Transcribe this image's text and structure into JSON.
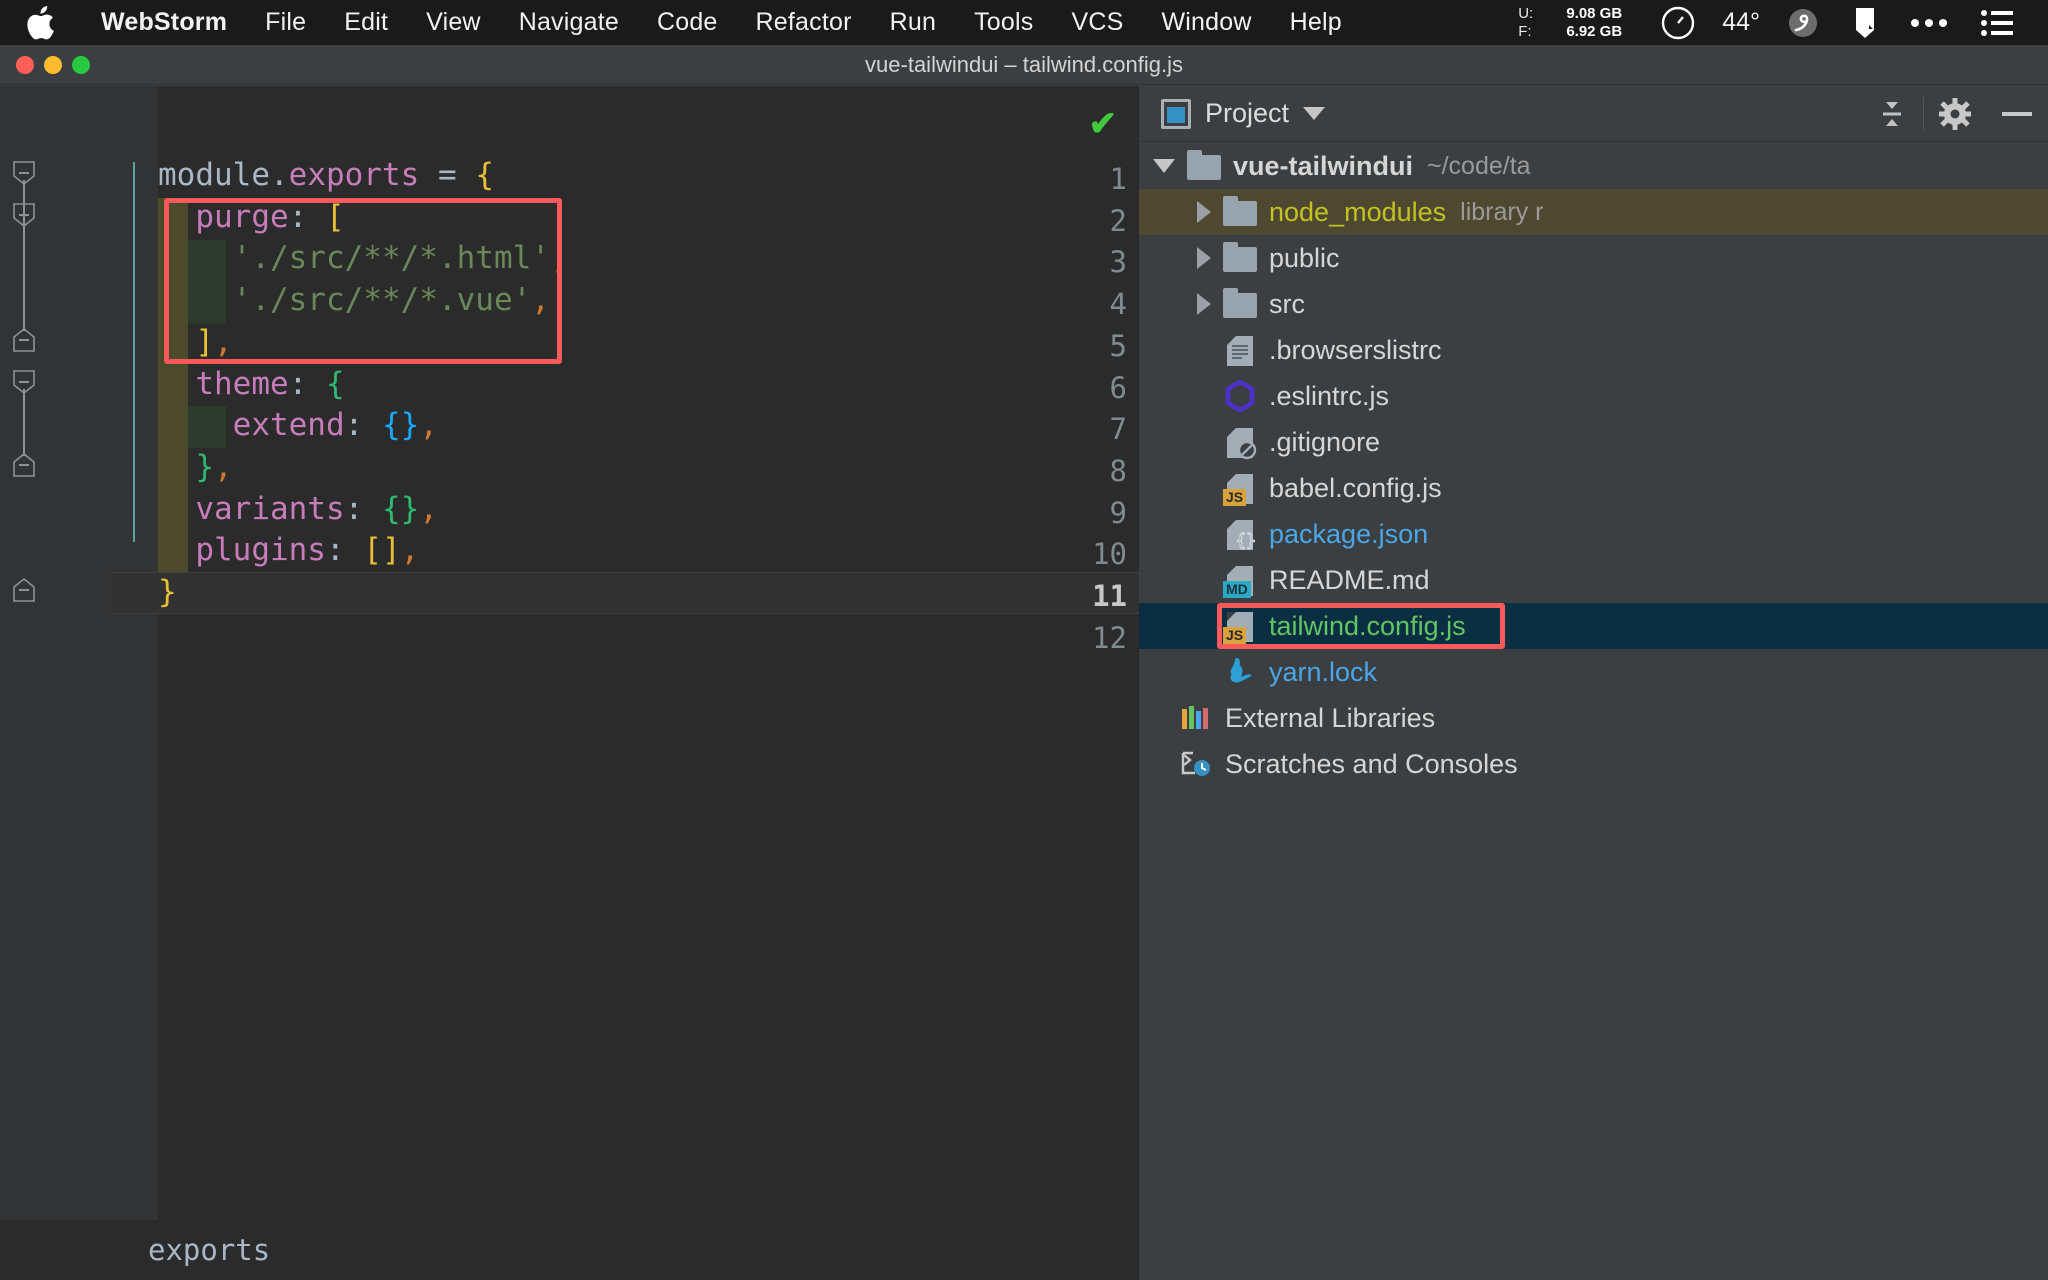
{
  "macmenu": {
    "apple_icon": "apple-logo",
    "items": [
      {
        "label": "WebStorm",
        "bold": true
      },
      {
        "label": "File",
        "bold": false
      },
      {
        "label": "Edit",
        "bold": false
      },
      {
        "label": "View",
        "bold": false
      },
      {
        "label": "Navigate",
        "bold": false
      },
      {
        "label": "Code",
        "bold": false
      },
      {
        "label": "Refactor",
        "bold": false
      },
      {
        "label": "Run",
        "bold": false
      },
      {
        "label": "Tools",
        "bold": false
      },
      {
        "label": "VCS",
        "bold": false
      },
      {
        "label": "Window",
        "bold": false
      },
      {
        "label": "Help",
        "bold": false
      }
    ],
    "status": {
      "mem_used_key": "U:",
      "mem_used_val": "9.08 GB",
      "mem_free_key": "F:",
      "mem_free_val": "6.92 GB",
      "gauge_icon": "speedometer-icon",
      "temperature": "44°",
      "cloud_icon": "cloud-sync-icon",
      "flag_icon": "flag-icon",
      "more_icon": "ellipsis-icon",
      "list_icon": "control-center-icon"
    }
  },
  "window": {
    "title": "vue-tailwindui – tailwind.config.js",
    "traffic": [
      "close-button",
      "minimize-button",
      "zoom-button"
    ]
  },
  "editor": {
    "inspection_badge": "✔",
    "line_numbers": [
      "1",
      "2",
      "3",
      "4",
      "5",
      "6",
      "7",
      "8",
      "9",
      "10",
      "11",
      "12"
    ],
    "current_line": 11,
    "lines": [
      {
        "n": 1,
        "tokens": [
          {
            "t": "module",
            "c": "t-def"
          },
          {
            "t": ".",
            "c": "t-op"
          },
          {
            "t": "exports",
            "c": "t-prop"
          },
          {
            "t": " = ",
            "c": "t-op"
          },
          {
            "t": "{",
            "c": "br-y"
          }
        ]
      },
      {
        "n": 2,
        "tokens": [
          {
            "t": "  ",
            "c": "t-op"
          },
          {
            "t": "purge",
            "c": "t-prop"
          },
          {
            "t": ":",
            "c": "t-colon"
          },
          {
            "t": " ",
            "c": "t-op"
          },
          {
            "t": "[",
            "c": "br-y"
          }
        ]
      },
      {
        "n": 3,
        "tokens": [
          {
            "t": "    ",
            "c": "t-op"
          },
          {
            "t": "'./src/**/*.html'",
            "c": "t-str"
          },
          {
            "t": ",",
            "c": "t-comma"
          }
        ]
      },
      {
        "n": 4,
        "tokens": [
          {
            "t": "    ",
            "c": "t-op"
          },
          {
            "t": "'./src/**/*.vue'",
            "c": "t-str"
          },
          {
            "t": ",",
            "c": "t-comma"
          }
        ]
      },
      {
        "n": 5,
        "tokens": [
          {
            "t": "  ",
            "c": "t-op"
          },
          {
            "t": "]",
            "c": "br-y"
          },
          {
            "t": ",",
            "c": "t-comma"
          }
        ]
      },
      {
        "n": 6,
        "tokens": [
          {
            "t": "  ",
            "c": "t-op"
          },
          {
            "t": "theme",
            "c": "t-prop"
          },
          {
            "t": ":",
            "c": "t-colon"
          },
          {
            "t": " ",
            "c": "t-op"
          },
          {
            "t": "{",
            "c": "br-g"
          }
        ]
      },
      {
        "n": 7,
        "tokens": [
          {
            "t": "    ",
            "c": "t-op"
          },
          {
            "t": "extend",
            "c": "t-prop"
          },
          {
            "t": ":",
            "c": "t-colon"
          },
          {
            "t": " ",
            "c": "t-op"
          },
          {
            "t": "{}",
            "c": "br-b"
          },
          {
            "t": ",",
            "c": "t-comma"
          }
        ]
      },
      {
        "n": 8,
        "tokens": [
          {
            "t": "  ",
            "c": "t-op"
          },
          {
            "t": "}",
            "c": "br-g"
          },
          {
            "t": ",",
            "c": "t-comma"
          }
        ]
      },
      {
        "n": 9,
        "tokens": [
          {
            "t": "  ",
            "c": "t-op"
          },
          {
            "t": "variants",
            "c": "t-prop"
          },
          {
            "t": ":",
            "c": "t-colon"
          },
          {
            "t": " ",
            "c": "t-op"
          },
          {
            "t": "{}",
            "c": "br-g"
          },
          {
            "t": ",",
            "c": "t-comma"
          }
        ]
      },
      {
        "n": 10,
        "tokens": [
          {
            "t": "  ",
            "c": "t-op"
          },
          {
            "t": "plugins",
            "c": "t-prop"
          },
          {
            "t": ":",
            "c": "t-colon"
          },
          {
            "t": " ",
            "c": "t-op"
          },
          {
            "t": "[]",
            "c": "br-y"
          },
          {
            "t": ",",
            "c": "t-comma"
          }
        ]
      },
      {
        "n": 11,
        "tokens": [
          {
            "t": "}",
            "c": "br-y"
          }
        ]
      },
      {
        "n": 12,
        "tokens": []
      }
    ],
    "annotation_box": "red-highlight-purge-block",
    "status_breadcrumb": "exports"
  },
  "project_panel": {
    "title": "Project",
    "dropdown_icon": "chevron-down-icon",
    "collapse_icon": "collapse-all-icon",
    "settings_icon": "gear-icon",
    "minimize_icon": "minimize-icon",
    "tree": [
      {
        "label": "vue-tailwindui",
        "sub": "~/code/ta",
        "arrow": "down",
        "icon": "folder",
        "depth": 0,
        "style": "root"
      },
      {
        "label": "node_modules",
        "sub": "library r",
        "arrow": "right",
        "icon": "folder",
        "depth": 1,
        "style": "nodemod"
      },
      {
        "label": "public",
        "sub": "",
        "arrow": "right",
        "icon": "folder",
        "depth": 1,
        "style": ""
      },
      {
        "label": "src",
        "sub": "",
        "arrow": "right",
        "icon": "folder",
        "depth": 1,
        "style": ""
      },
      {
        "label": ".browserslistrc",
        "sub": "",
        "arrow": "none",
        "icon": "file-text",
        "depth": 1,
        "style": ""
      },
      {
        "label": ".eslintrc.js",
        "sub": "",
        "arrow": "none",
        "icon": "eslint",
        "depth": 1,
        "style": ""
      },
      {
        "label": ".gitignore",
        "sub": "",
        "arrow": "none",
        "icon": "file-ignored",
        "depth": 1,
        "style": ""
      },
      {
        "label": "babel.config.js",
        "sub": "",
        "arrow": "none",
        "icon": "file-js",
        "depth": 1,
        "style": ""
      },
      {
        "label": "package.json",
        "sub": "",
        "arrow": "none",
        "icon": "file-json",
        "depth": 1,
        "style": "blue"
      },
      {
        "label": "README.md",
        "sub": "",
        "arrow": "none",
        "icon": "file-md",
        "depth": 1,
        "style": ""
      },
      {
        "label": "tailwind.config.js",
        "sub": "",
        "arrow": "none",
        "icon": "file-js",
        "depth": 1,
        "style": "selected"
      },
      {
        "label": "yarn.lock",
        "sub": "",
        "arrow": "none",
        "icon": "yarn",
        "depth": 1,
        "style": "blue"
      },
      {
        "label": "External Libraries",
        "sub": "",
        "arrow": "none",
        "icon": "libraries",
        "depth": 0,
        "style": ""
      },
      {
        "label": "Scratches and Consoles",
        "sub": "",
        "arrow": "none",
        "icon": "scratches",
        "depth": 0,
        "style": ""
      }
    ],
    "annotation_box": "red-highlight-tailwind-config"
  },
  "colors": {
    "accent_red_box": "#fc5a5a",
    "selection_bg": "#0a2f42",
    "selected_text": "#62c462",
    "string_green": "#6a8759",
    "property_pink": "#c77dbb",
    "bracket_yellow": "#e8bf36",
    "bracket_green": "#2eb872",
    "bracket_blue": "#1aa7ff",
    "comma_orange": "#cc7832",
    "nodemodules_yellow": "#c2c220"
  }
}
